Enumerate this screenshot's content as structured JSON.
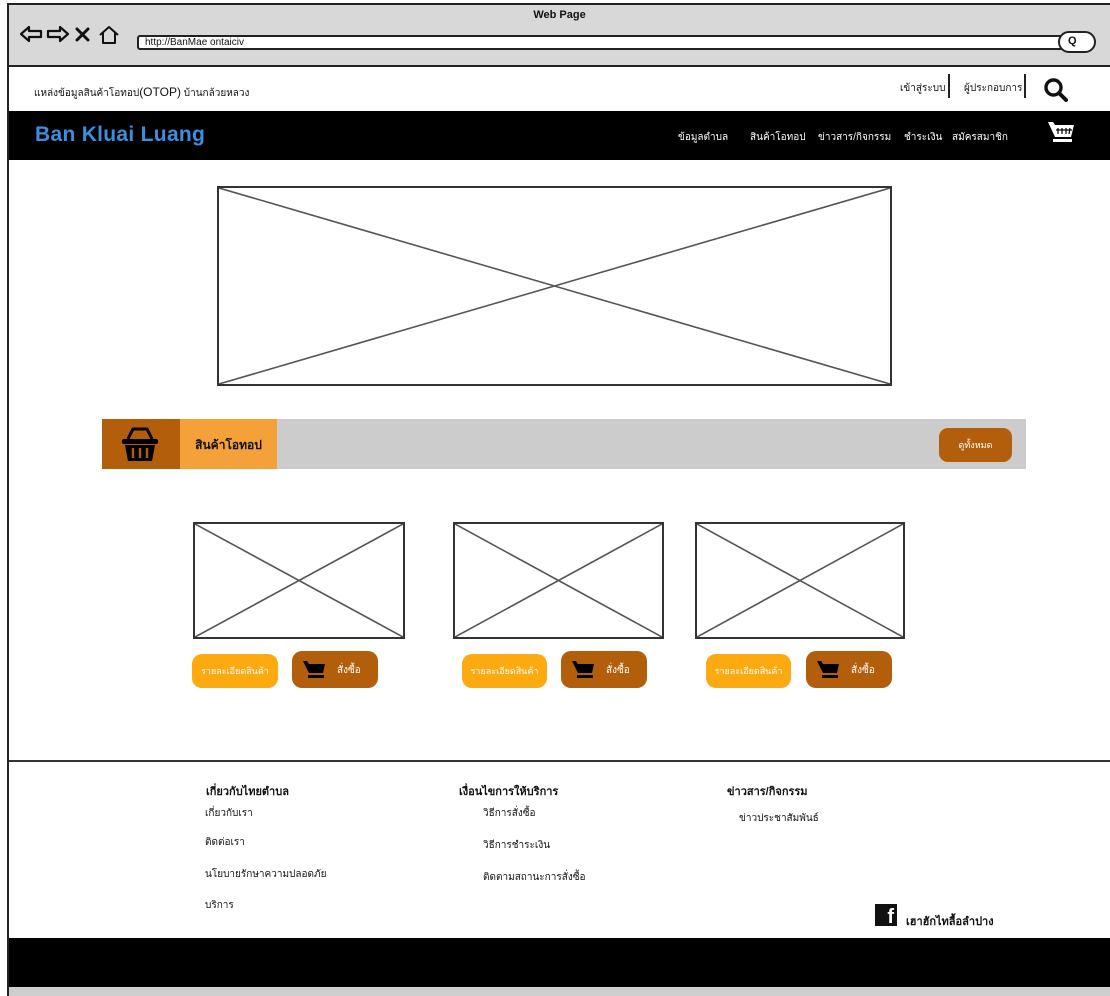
{
  "window": {
    "title": "Web Page",
    "url": "http://BanMae ontaiciv"
  },
  "topbar": {
    "tagline_prefix": "แหล่งข้อมูลสินค้าโอทอป",
    "tagline_otop": "(OTOP)",
    "tagline_suffix": "บ้านกล้วยหลวง",
    "login": "เข้าสู่ระบบ",
    "entrepreneur": "ผู้ประกอบการ"
  },
  "header": {
    "brand": "Ban Kluai Luang",
    "nav": [
      "ข้อมูลตำบล",
      "สินค้าโอทอป",
      "ข่าวสาร/กิจกรรม",
      "ชำระเงิน",
      "สมัครสมาชิก"
    ]
  },
  "section": {
    "title": "สินค้าโอทอป",
    "see_all": "ดูทั้งหมด"
  },
  "products": [
    {
      "detail_label": "รายละเอียดสินค้า",
      "order_label": "สั่งซื้อ"
    },
    {
      "detail_label": "รายละเอียดสินค้า",
      "order_label": "สั่งซื้อ"
    },
    {
      "detail_label": "รายละเอียดสินค้า",
      "order_label": "สั่งซื้อ"
    }
  ],
  "footer": {
    "col1": {
      "heading": "เกี่ยวกับไทยตำบล",
      "links": [
        "เกี่ยวกับเรา",
        "ติดต่อเรา",
        "นโยบายรักษาความปลอดภัย",
        "บริการ"
      ]
    },
    "col2": {
      "heading": "เงื่อนไขการให้บริการ",
      "links": [
        "วิธีการสั่งซื้อ",
        "วิธีการชำระเงิน",
        "ติดตามสถานะการสั่งซื้อ"
      ]
    },
    "col3": {
      "heading": "ข่าวสาร/กิจกรรม",
      "links": [
        "ข่าวประชาสัมพันธ์"
      ]
    },
    "facebook_label": "เฮาฮักไทลื้อลำปาง"
  },
  "icons": {
    "back": "back-arrow-icon",
    "forward": "forward-arrow-icon",
    "stop": "close-icon",
    "home": "home-icon",
    "search": "search-icon",
    "cart": "cart-icon",
    "basket": "basket-icon",
    "facebook": "facebook-icon"
  },
  "colors": {
    "brand_blue": "#3b8fe0",
    "brown": "#b35e0b",
    "orange": "#fdaa11",
    "title_orange": "#f5a13a",
    "header_black": "#000000",
    "section_grey": "#cccccc"
  }
}
